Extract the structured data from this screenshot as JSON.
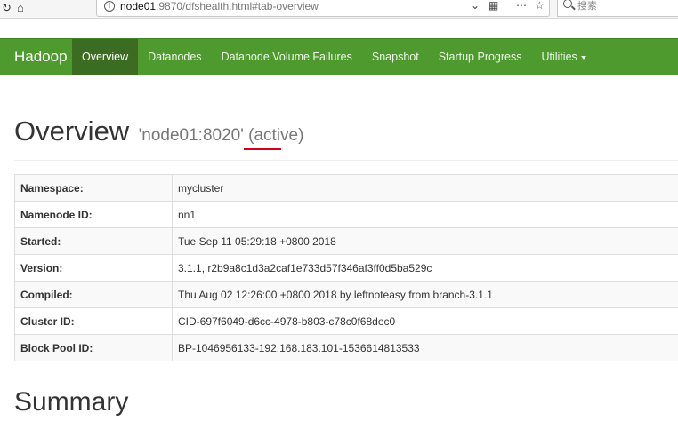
{
  "browser": {
    "url_host": "node01",
    "url_rest": ":9870/dfshealth.html#tab-overview",
    "search_placeholder": "搜索"
  },
  "navbar": {
    "brand": "Hadoop",
    "items": [
      {
        "label": "Overview",
        "active": true
      },
      {
        "label": "Datanodes"
      },
      {
        "label": "Datanode Volume Failures"
      },
      {
        "label": "Snapshot"
      },
      {
        "label": "Startup Progress"
      },
      {
        "label": "Utilities"
      }
    ]
  },
  "page": {
    "title": "Overview",
    "subtitle": "'node01:8020' (active)"
  },
  "overview_table": [
    {
      "key": "Namespace:",
      "value": "mycluster"
    },
    {
      "key": "Namenode ID:",
      "value": "nn1"
    },
    {
      "key": "Started:",
      "value": "Tue Sep 11 05:29:18 +0800 2018"
    },
    {
      "key": "Version:",
      "value": "3.1.1, r2b9a8c1d3a2caf1e733d57f346af3ff0d5ba529c"
    },
    {
      "key": "Compiled:",
      "value": "Thu Aug 02 12:26:00 +0800 2018 by leftnoteasy from branch-3.1.1"
    },
    {
      "key": "Cluster ID:",
      "value": "CID-697f6049-d6cc-4978-b803-c78c0f68dec0"
    },
    {
      "key": "Block Pool ID:",
      "value": "BP-1046956133-192.168.183.101-1536614813533"
    }
  ],
  "summary_title": "Summary",
  "colors": {
    "navbar": "#4e9a2f",
    "navbar_active": "#3b6c22",
    "annotation": "#d0021b"
  }
}
